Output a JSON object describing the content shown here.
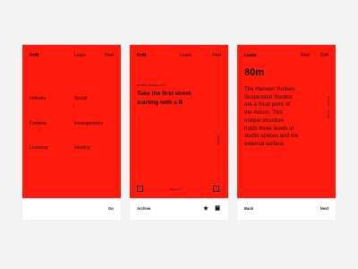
{
  "screen1": {
    "nav": {
      "left": "Drift",
      "center": "Learn",
      "right": "Find"
    },
    "topics": [
      "Intimate",
      "Social",
      "Creative",
      "Homogenious",
      "Learning",
      "Healing"
    ],
    "footer": {
      "action": "Go"
    }
  },
  "screen2": {
    "nav": {
      "left": "Drift",
      "center": "Learn",
      "right": "Find"
    },
    "meta": "Building | 30 Mins | 2 Hr",
    "headline_line1": "Take the first street",
    "headline_line2": "starting with a B",
    "side_label": "SOUTH",
    "pager": {
      "prev_icon": "‹",
      "label": "Step 4 / 7",
      "next_icon": "›"
    },
    "footer": {
      "action": "Archive"
    }
  },
  "screen3": {
    "nav": {
      "left": "Learn",
      "center": "Find",
      "right": "Drift"
    },
    "distance": "80m",
    "description_lines": [
      "The Hansen Yunken",
      "Suspended Studios",
      "are a focal point of",
      "the Atrium. This",
      "unique structure",
      "holds three levels of",
      "studio spaces and the",
      "external surface"
    ],
    "side_label": "ATRIUM · FLOOR",
    "footer": {
      "back": "Back",
      "next": "Next"
    }
  }
}
